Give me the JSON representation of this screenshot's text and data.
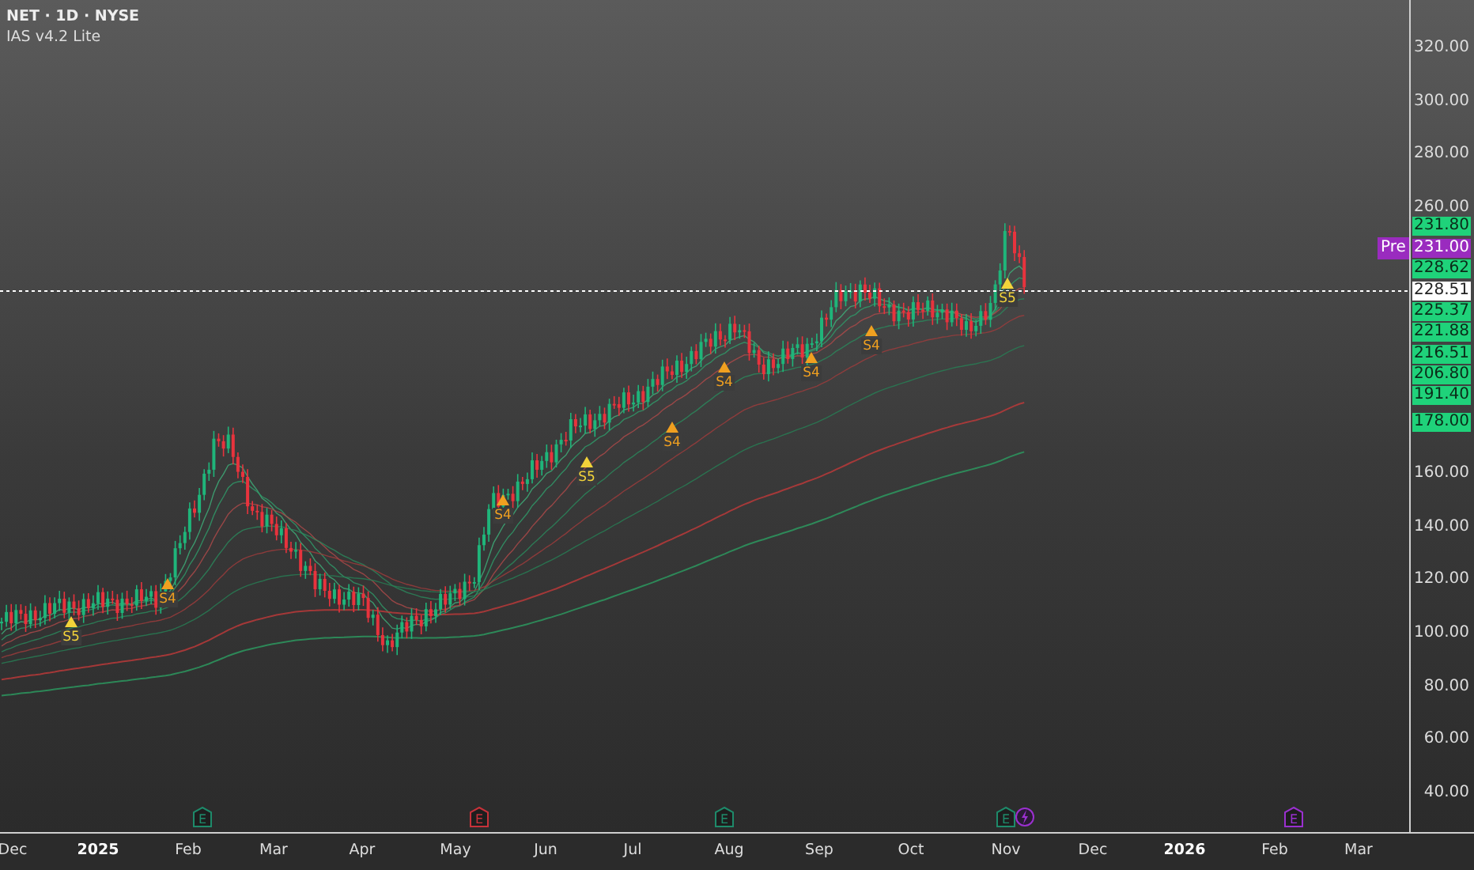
{
  "header": {
    "title": "NET · 1D · NYSE",
    "indicator": "IAS v4.2 Lite"
  },
  "price_axis": {
    "ticks": [
      "320.00",
      "300.00",
      "280.00",
      "260.00",
      "160.00",
      "140.00",
      "120.00",
      "100.00",
      "80.00",
      "60.00",
      "40.00"
    ]
  },
  "price_tags": [
    {
      "text": "231.80",
      "kind": "level"
    },
    {
      "label": "Pre",
      "text": "231.00",
      "kind": "premarket"
    },
    {
      "text": "228.62",
      "kind": "level"
    },
    {
      "text": "228.51",
      "kind": "last"
    },
    {
      "text": "225.37",
      "kind": "level"
    },
    {
      "text": "221.88",
      "kind": "level"
    },
    {
      "text": "216.51",
      "kind": "level"
    },
    {
      "text": "206.80",
      "kind": "level"
    },
    {
      "text": "191.40",
      "kind": "level"
    },
    {
      "text": "178.00",
      "kind": "level"
    }
  ],
  "signals": [
    {
      "label": "S5",
      "color": "#f2d33a"
    },
    {
      "label": "S4",
      "color": "#f0a020"
    },
    {
      "label": "S4",
      "color": "#f0a020"
    },
    {
      "label": "S5",
      "color": "#f2d33a"
    },
    {
      "label": "S4",
      "color": "#f0a020"
    },
    {
      "label": "S4",
      "color": "#f0a020"
    },
    {
      "label": "S4",
      "color": "#f0a020"
    },
    {
      "label": "S4",
      "color": "#f0a020"
    },
    {
      "label": "S5",
      "color": "#f2d33a"
    }
  ],
  "events": [
    {
      "kind": "letter",
      "label": "E",
      "color": "#1e8a6a"
    },
    {
      "kind": "letter",
      "label": "E",
      "color": "#c8323a"
    },
    {
      "kind": "letter",
      "label": "E",
      "color": "#1e8a6a"
    },
    {
      "kind": "letter",
      "label": "E",
      "color": "#1e8a6a"
    },
    {
      "kind": "lightning",
      "color": "#9b30d0"
    },
    {
      "kind": "letter",
      "label": "E",
      "color": "#9b30d0"
    }
  ],
  "time_axis": {
    "labels": [
      {
        "text": "Dec",
        "kind": "month"
      },
      {
        "text": "2025",
        "kind": "year"
      },
      {
        "text": "Feb",
        "kind": "month"
      },
      {
        "text": "Mar",
        "kind": "month"
      },
      {
        "text": "Apr",
        "kind": "month"
      },
      {
        "text": "May",
        "kind": "month"
      },
      {
        "text": "Jun",
        "kind": "month"
      },
      {
        "text": "Jul",
        "kind": "month"
      },
      {
        "text": "Aug",
        "kind": "month"
      },
      {
        "text": "Sep",
        "kind": "month"
      },
      {
        "text": "Oct",
        "kind": "month"
      },
      {
        "text": "Nov",
        "kind": "month"
      },
      {
        "text": "Dec",
        "kind": "month"
      },
      {
        "text": "2026",
        "kind": "year"
      },
      {
        "text": "Feb",
        "kind": "month"
      },
      {
        "text": "Mar",
        "kind": "month"
      }
    ]
  }
}
